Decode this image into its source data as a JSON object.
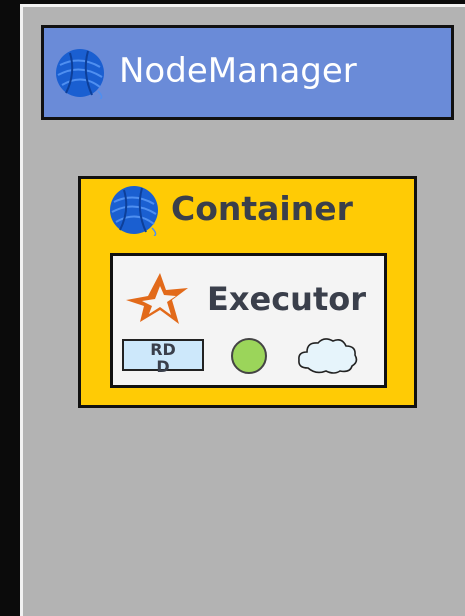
{
  "node_manager": {
    "title": "NodeManager",
    "icon": "yarn-ball-icon",
    "fill": "#6a8bd8"
  },
  "container": {
    "title": "Container",
    "icon": "yarn-ball-icon",
    "fill": "#ffcb05"
  },
  "executor": {
    "title": "Executor",
    "icon": "spark-star-icon",
    "fill": "#f4f4f4",
    "items": {
      "rdd_label": "RDD",
      "circle_icon": "task-circle-icon",
      "cloud_icon": "cache-cloud-icon"
    }
  },
  "colors": {
    "panel": "#b3b3b3",
    "yarn_blue": "#1a5fd1",
    "spark_orange": "#e26a1a",
    "rdd_fill": "#cde8fb",
    "circle_fill": "#9bd55a",
    "cloud_fill": "#e6f4fb",
    "text_dark": "#3a3f4b"
  }
}
